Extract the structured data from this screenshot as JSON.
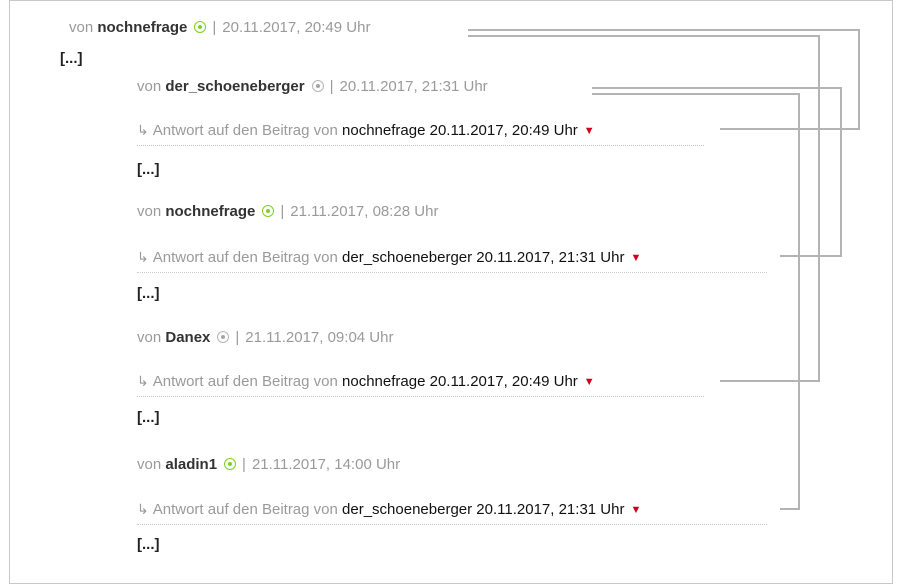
{
  "thread": {
    "root": {
      "by": "von",
      "user": "nochnefrage",
      "status": "online",
      "sep": "|",
      "time": "20.11.2017, 20:49 Uhr",
      "body": "[...]"
    },
    "replies": [
      {
        "by": "von",
        "user": "der_schoeneberger",
        "status": "offline",
        "sep": "|",
        "time": "20.11.2017, 21:31 Uhr",
        "reply_prefix": "Antwort auf den Beitrag von",
        "reply_user": "nochnefrage",
        "reply_time": "20.11.2017, 20:49 Uhr",
        "body": "[...]"
      },
      {
        "by": "von",
        "user": "nochnefrage",
        "status": "online",
        "sep": "|",
        "time": "21.11.2017, 08:28 Uhr",
        "reply_prefix": "Antwort auf den Beitrag von",
        "reply_user": "der_schoeneberger",
        "reply_time": "20.11.2017, 21:31 Uhr",
        "body": "[...]"
      },
      {
        "by": "von",
        "user": "Danex",
        "status": "offline",
        "sep": "|",
        "time": "21.11.2017, 09:04 Uhr",
        "reply_prefix": "Antwort auf den Beitrag von",
        "reply_user": "nochnefrage",
        "reply_time": "20.11.2017, 20:49 Uhr",
        "body": "[...]"
      },
      {
        "by": "von",
        "user": "aladin1",
        "status": "online",
        "sep": "|",
        "time": "21.11.2017, 14:00 Uhr",
        "reply_prefix": "Antwort auf den Beitrag von",
        "reply_user": "der_schoeneberger",
        "reply_time": "20.11.2017, 21:31 Uhr",
        "body": "[...]"
      }
    ]
  },
  "icons": {
    "reply_arrow": "reply-arrow-icon",
    "expand": "red-triangle-down-icon",
    "status": "status-dot-icon"
  },
  "colors": {
    "online": "#7ed321",
    "offline": "#b5b5b5",
    "triangle": "#d0021b",
    "connector": "#b4b4b4"
  }
}
